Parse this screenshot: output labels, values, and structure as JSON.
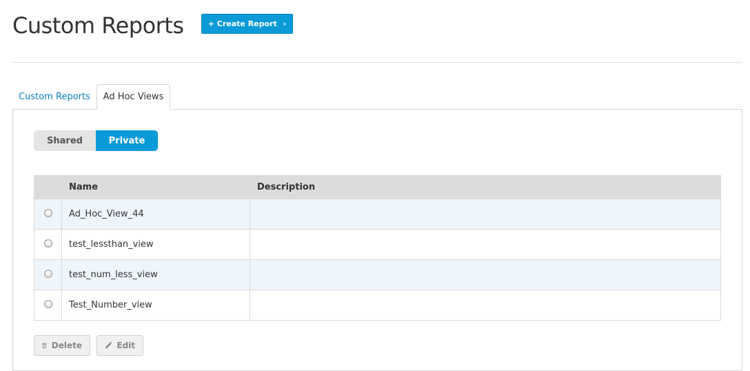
{
  "header": {
    "title": "Custom Reports",
    "create_button": "+ Create Report",
    "create_chevron": "›"
  },
  "tabs": [
    {
      "label": "Custom Reports",
      "active": false
    },
    {
      "label": "Ad Hoc Views",
      "active": true
    }
  ],
  "toggle": {
    "shared": "Shared",
    "private": "Private",
    "selected": "Private"
  },
  "table": {
    "columns": [
      "Name",
      "Description"
    ],
    "rows": [
      {
        "name": "Ad_Hoc_View_44",
        "description": ""
      },
      {
        "name": "test_lessthan_view",
        "description": ""
      },
      {
        "name": "test_num_less_view",
        "description": ""
      },
      {
        "name": "Test_Number_view",
        "description": ""
      }
    ]
  },
  "actions": {
    "delete": "Delete",
    "edit": "Edit"
  },
  "colors": {
    "accent": "#0a9ad8",
    "link": "#0a7bc2",
    "row_alt": "#eef5fb",
    "header_bg": "#dcdcdc"
  },
  "icons": {
    "delete": "trash-icon",
    "edit": "pencil-icon",
    "create_chevron": "chevron-right-icon"
  }
}
